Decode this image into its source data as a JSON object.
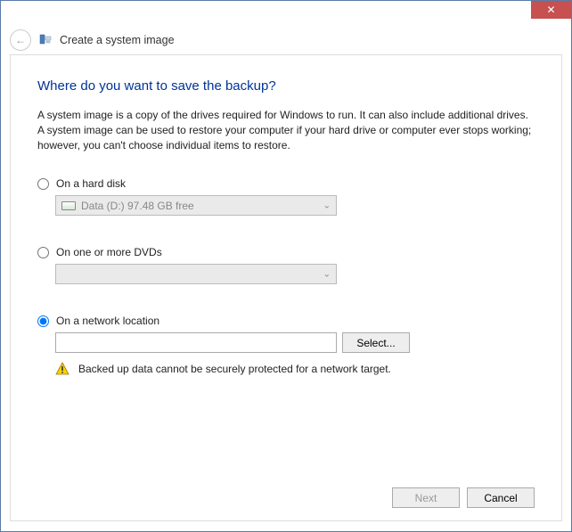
{
  "window": {
    "close_glyph": "✕"
  },
  "header": {
    "back_glyph": "←",
    "title": "Create a system image"
  },
  "main": {
    "heading": "Where do you want to save the backup?",
    "description": "A system image is a copy of the drives required for Windows to run. It can also include additional drives. A system image can be used to restore your computer if your hard drive or computer ever stops working; however, you can't choose individual items to restore."
  },
  "options": {
    "hard_disk": {
      "label": "On a hard disk",
      "selected_drive": "Data (D:)  97.48 GB free",
      "checked": false
    },
    "dvds": {
      "label": "On one or more DVDs",
      "selected_drive": "",
      "checked": false
    },
    "network": {
      "label": "On a network location",
      "path_value": "",
      "select_button": "Select...",
      "warning": "Backed up data cannot be securely protected for a network target.",
      "checked": true
    }
  },
  "footer": {
    "next": "Next",
    "cancel": "Cancel"
  }
}
